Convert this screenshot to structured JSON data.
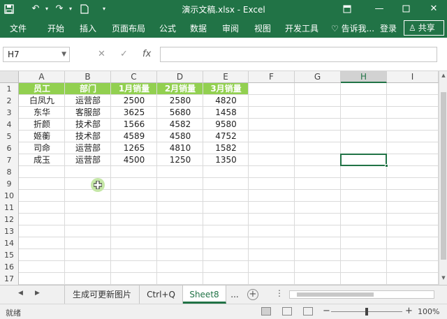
{
  "window": {
    "title": "演示文稿.xlsx - Excel"
  },
  "ribbon": {
    "tabs": [
      "文件",
      "开始",
      "插入",
      "页面布局",
      "公式",
      "数据",
      "审阅",
      "视图",
      "开发工具"
    ],
    "tell_me": "告诉我...",
    "login": "登录",
    "share": "共享"
  },
  "formula_bar": {
    "name_box": "H7",
    "fx_label": "fx",
    "value": ""
  },
  "grid": {
    "columns": [
      "A",
      "B",
      "C",
      "D",
      "E",
      "F",
      "G",
      "H",
      "I"
    ],
    "selected_column": "H",
    "rows": [
      "1",
      "2",
      "3",
      "4",
      "5",
      "6",
      "7",
      "8",
      "9",
      "10",
      "11",
      "12",
      "13",
      "14",
      "15",
      "16",
      "17"
    ],
    "header_row": [
      "员工",
      "部门",
      "1月销量",
      "2月销量",
      "3月销量"
    ],
    "data_rows": [
      [
        "白凤九",
        "运营部",
        "2500",
        "2580",
        "4820"
      ],
      [
        "东华",
        "客服部",
        "3625",
        "5680",
        "1458"
      ],
      [
        "折颜",
        "技术部",
        "1566",
        "4582",
        "9580"
      ],
      [
        "姬蘅",
        "技术部",
        "4589",
        "4580",
        "4752"
      ],
      [
        "司命",
        "运营部",
        "1265",
        "4810",
        "1582"
      ],
      [
        "成玉",
        "运营部",
        "4500",
        "1250",
        "1350"
      ]
    ],
    "active_cell": "H7",
    "header_fill": "#92d050"
  },
  "sheet_tabs": {
    "tabs": [
      "生成可更新图片",
      "Ctrl+Q",
      "Sheet8"
    ],
    "active": "Sheet8",
    "more": "..."
  },
  "status_bar": {
    "status": "就绪",
    "zoom": "100%"
  },
  "colors": {
    "accent": "#217346"
  }
}
